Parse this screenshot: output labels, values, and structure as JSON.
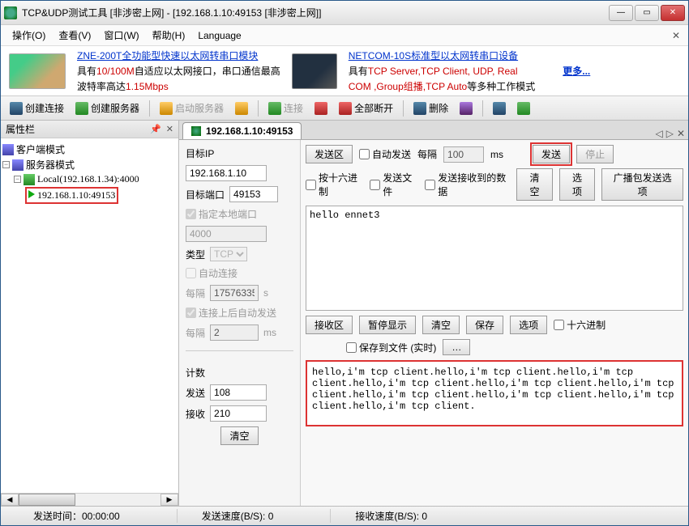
{
  "title": "TCP&UDP测试工具 [非涉密上网] - [192.168.1.10:49153 [非涉密上网]]",
  "menu": {
    "ops": "操作(O)",
    "view": "查看(V)",
    "window": "窗口(W)",
    "help": "帮助(H)",
    "lang": "Language"
  },
  "promo1": {
    "title": "ZNE-200T全功能型快速以太网转串口模块",
    "l1a": "具有",
    "l1b": "10/100M",
    "l1c": "自适应以太网接口，串口通信最高",
    "l2a": "波特率高达",
    "l2b": "1.15Mbps"
  },
  "promo2": {
    "title": "NETCOM-10S标准型以太网转串口设备",
    "l1a": "具有",
    "l1b": "TCP Server,TCP Client, UDP, Real",
    "l2a": "COM ,Group组播,TCP Auto",
    "l2b": "等多种工作模式",
    "more": "更多..."
  },
  "tb": {
    "createConn": "创建连接",
    "createSrv": "创建服务器",
    "startSrv": "启动服务器",
    "conn": "连接",
    "disAll": "全部断开",
    "del": "删除"
  },
  "left": {
    "hdr": "属性栏",
    "clientMode": "客户端模式",
    "serverMode": "服务器模式",
    "local": "Local(192.168.1.34):4000",
    "activeConn": "192.168.1.10:49153"
  },
  "tab": {
    "label": "192.168.1.10:49153"
  },
  "prop": {
    "destIp": "目标IP",
    "destIpVal": "192.168.1.10",
    "destPort": "目标端口",
    "destPortVal": "49153",
    "bindLocal": "指定本地端口",
    "localPortVal": "4000",
    "type": "类型",
    "typeVal": "TCP",
    "autoConn": "自动连接",
    "interval": "每隔",
    "intVal": "17576335",
    "s": "s",
    "autoSendOnConn": "连接上后自动发送",
    "int2": "每隔",
    "int2Val": "2",
    "ms": "ms",
    "count": "计数",
    "send": "发送",
    "sendVal": "108",
    "recv": "接收",
    "recvVal": "210",
    "clear": "清空"
  },
  "sendArea": {
    "title": "发送区",
    "autoSend": "自动发送",
    "interval": "每隔",
    "intVal": "100",
    "ms": "ms",
    "sendBtn": "发送",
    "stopBtn": "停止",
    "hex": "按十六进制",
    "sendFile": "发送文件",
    "recvData": "发送接收到的数据",
    "clear": "清空",
    "options": "选项",
    "broadcast": "广播包发送选项",
    "text": "hello ennet3"
  },
  "recvArea": {
    "title": "接收区",
    "pause": "暂停显示",
    "clear": "清空",
    "save": "保存",
    "options": "选项",
    "hex": "十六进制",
    "saveFile": "保存到文件 (实时)",
    "text": "hello,i'm tcp client.hello,i'm tcp client.hello,i'm tcp client.hello,i'm tcp client.hello,i'm tcp client.hello,i'm tcp client.hello,i'm tcp client.hello,i'm tcp client.hello,i'm tcp client.hello,i'm tcp client."
  },
  "status": {
    "sendTime": "发送时间：00:00:00",
    "sendSpeed": "发送速度(B/S): 0",
    "recvSpeed": "接收速度(B/S): 0"
  }
}
